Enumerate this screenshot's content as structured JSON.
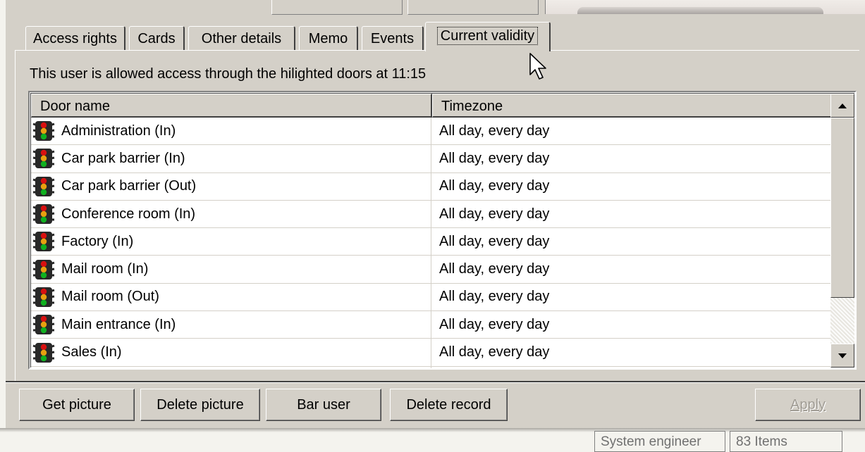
{
  "tabs": [
    {
      "label": "Access rights"
    },
    {
      "label": "Cards"
    },
    {
      "label": "Other details"
    },
    {
      "label": "Memo"
    },
    {
      "label": "Events"
    },
    {
      "label": "Current validity",
      "active": true
    }
  ],
  "info_text": "This user is allowed access through the hilighted doors at 11:15",
  "table": {
    "columns": [
      "Door name",
      "Timezone"
    ],
    "rows": [
      {
        "door": "Administration (In)",
        "timezone": "All day, every day"
      },
      {
        "door": "Car park barrier (In)",
        "timezone": "All day, every day"
      },
      {
        "door": "Car park barrier (Out)",
        "timezone": "All day, every day"
      },
      {
        "door": "Conference room (In)",
        "timezone": "All day, every day"
      },
      {
        "door": "Factory (In)",
        "timezone": "All day, every day"
      },
      {
        "door": "Mail room (In)",
        "timezone": "All day, every day"
      },
      {
        "door": "Mail room (Out)",
        "timezone": "All day, every day"
      },
      {
        "door": "Main entrance (In)",
        "timezone": "All day, every day"
      },
      {
        "door": "Sales (In)",
        "timezone": "All day, every day"
      }
    ],
    "row_icon": "traffic-light-icon"
  },
  "buttons": {
    "get_picture": "Get picture",
    "delete_picture": "Delete picture",
    "bar_user": "Bar user",
    "delete_record": "Delete record",
    "apply": "Apply"
  },
  "status": {
    "role": "System engineer",
    "items": "83 Items"
  },
  "colors": {
    "face": "#d4d0c8",
    "light_red": "#d81010",
    "light_amber": "#e8a010",
    "light_green": "#10b020"
  }
}
